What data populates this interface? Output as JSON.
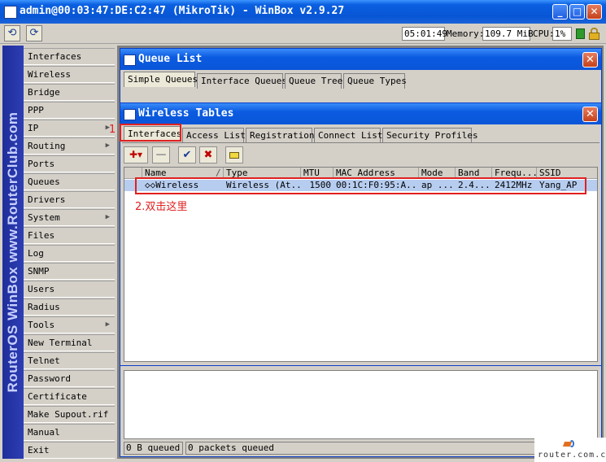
{
  "app": {
    "title": "admin@00:03:47:DE:C2:47 (MikroTik) - WinBox v2.9.27",
    "minimize": "_",
    "maximize": "□",
    "close": "✕"
  },
  "toolbar": {
    "undo_icon": "undo-icon",
    "redo_icon": "redo-icon",
    "time": "05:01:49",
    "memory_label": "Memory:",
    "memory_value": "109.7 MiB",
    "cpu_label": "CPU:",
    "cpu_value": "1%",
    "status_color": "#2c9a2c"
  },
  "brand": {
    "text": "RouterOS WinBox   www.RouterClub.com"
  },
  "menu": {
    "items": [
      {
        "label": "Interfaces",
        "sub": false
      },
      {
        "label": "Wireless",
        "sub": false
      },
      {
        "label": "Bridge",
        "sub": false
      },
      {
        "label": "PPP",
        "sub": false
      },
      {
        "label": "IP",
        "sub": true
      },
      {
        "label": "Routing",
        "sub": true
      },
      {
        "label": "Ports",
        "sub": false
      },
      {
        "label": "Queues",
        "sub": false
      },
      {
        "label": "Drivers",
        "sub": false
      },
      {
        "label": "System",
        "sub": true
      },
      {
        "label": "Files",
        "sub": false
      },
      {
        "label": "Log",
        "sub": false
      },
      {
        "label": "SNMP",
        "sub": false
      },
      {
        "label": "Users",
        "sub": false
      },
      {
        "label": "Radius",
        "sub": false
      },
      {
        "label": "Tools",
        "sub": true
      },
      {
        "label": "New Terminal",
        "sub": false
      },
      {
        "label": "Telnet",
        "sub": false
      },
      {
        "label": "Password",
        "sub": false
      },
      {
        "label": "Certificate",
        "sub": false
      },
      {
        "label": "Make Supout.rif",
        "sub": false
      },
      {
        "label": "Manual",
        "sub": false
      },
      {
        "label": "Exit",
        "sub": false
      }
    ]
  },
  "queue_list": {
    "title": "Queue List",
    "tabs": [
      "Simple Queues",
      "Interface Queues",
      "Queue Tree",
      "Queue Types"
    ],
    "status_bytes": "0 B queued",
    "status_packets": "0 packets queued"
  },
  "wireless_tables": {
    "title": "Wireless Tables",
    "tabs": [
      "Interfaces",
      "Access List",
      "Registration",
      "Connect List",
      "Security Profiles"
    ],
    "columns": [
      "Name",
      "Type",
      "MTU",
      "MAC Address",
      "Mode",
      "Band",
      "Frequ...",
      "SSID"
    ],
    "rows": [
      {
        "name": "◇◇Wireless",
        "type": "Wireless (At...",
        "mtu": "1500",
        "mac": "00:1C:F0:95:A...",
        "mode": "ap ...",
        "band": "2.4...",
        "freq": "2412MHz",
        "ssid": "Yang_AP"
      }
    ],
    "toolbar_add": "✚▾",
    "toolbar_remove": "—",
    "toolbar_enable": "✔",
    "toolbar_disable": "✖"
  },
  "annotations": {
    "step1": "1",
    "step2": "2.双击这里"
  },
  "watermark": "router.com.cn"
}
